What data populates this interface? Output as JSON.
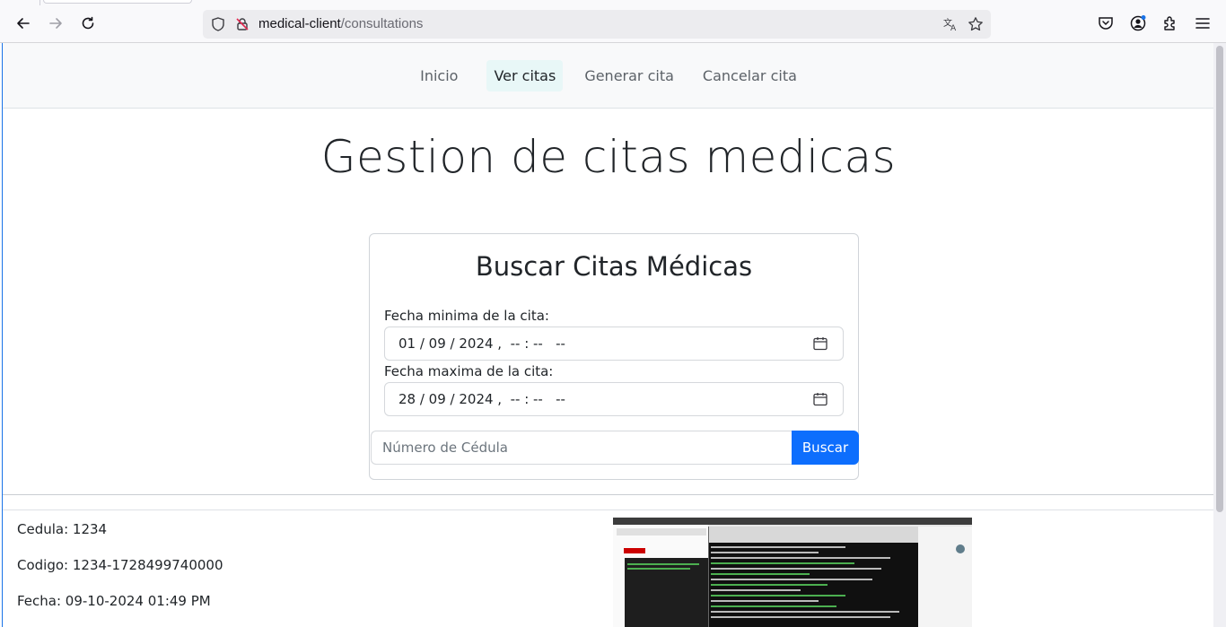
{
  "browser": {
    "url_host": "medical-client",
    "url_path": "/consultations"
  },
  "nav": {
    "items": [
      {
        "label": "Inicio",
        "active": false
      },
      {
        "label": "Ver citas",
        "active": true
      },
      {
        "label": "Generar cita",
        "active": false
      },
      {
        "label": "Cancelar cita",
        "active": false
      }
    ]
  },
  "page": {
    "title": "Gestion de citas medicas"
  },
  "search_card": {
    "title": "Buscar Citas Médicas",
    "min_date_label": "Fecha minima de la cita:",
    "min_date_value": "01 / 09 / 2024 ,  -- : --   --",
    "max_date_label": "Fecha maxima de la cita:",
    "max_date_value": "28 / 09 / 2024 ,  -- : --   --",
    "cedula_placeholder": "Número de Cédula",
    "search_button": "Buscar"
  },
  "result": {
    "cedula": "Cedula: 1234",
    "codigo": "Codigo: 1234-1728499740000",
    "fecha": "Fecha: 09-10-2024 01:49 PM"
  },
  "colors": {
    "primary": "#0d6efd",
    "navbar_bg": "#f8f9fa",
    "active_nav_bg": "#e8f7f7"
  }
}
